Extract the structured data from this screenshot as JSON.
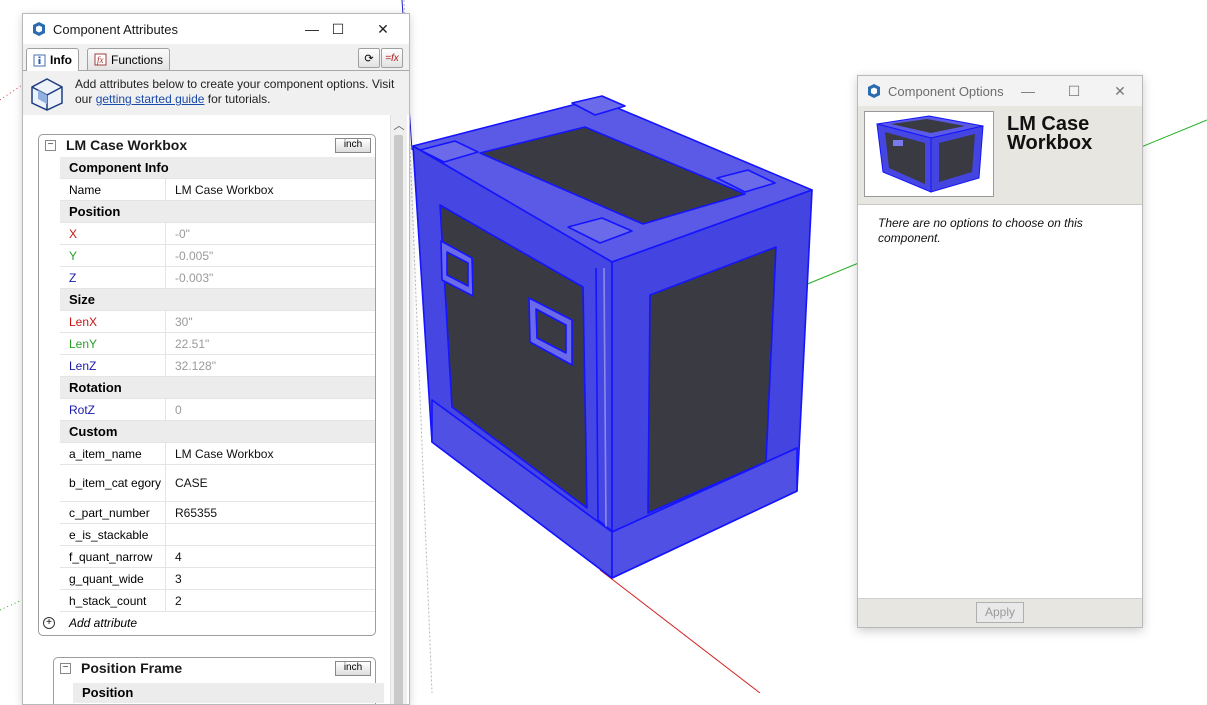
{
  "attributes_window": {
    "title": "Component Attributes",
    "tabs": [
      {
        "label": "Info",
        "icon": "info-icon"
      },
      {
        "label": "Functions",
        "icon": "functions-icon"
      }
    ],
    "toolbar_icons": [
      "refresh-icon",
      "formula-toggle-icon"
    ],
    "banner": {
      "text_before": "Add attributes below to create your component options. Visit our ",
      "link": "getting started guide",
      "text_after": " for tutorials."
    },
    "component": {
      "title": "LM Case Workbox",
      "unit": "inch",
      "groups": [
        {
          "label": "Component Info",
          "rows": [
            {
              "name": "Name",
              "value": "LM Case Workbox",
              "name_color": "default",
              "ghost": false
            }
          ]
        },
        {
          "label": "Position",
          "rows": [
            {
              "name": "X",
              "value": "-0\"",
              "name_color": "#c41515",
              "ghost": true
            },
            {
              "name": "Y",
              "value": "-0.005\"",
              "name_color": "#2aa02a",
              "ghost": true
            },
            {
              "name": "Z",
              "value": "-0.003\"",
              "name_color": "#1a1aa8",
              "ghost": true
            }
          ]
        },
        {
          "label": "Size",
          "rows": [
            {
              "name": "LenX",
              "value": "30\"",
              "name_color": "#c41515",
              "ghost": true
            },
            {
              "name": "LenY",
              "value": "22.51\"",
              "name_color": "#2aa02a",
              "ghost": true
            },
            {
              "name": "LenZ",
              "value": "32.128\"",
              "name_color": "#1a1aa8",
              "ghost": true
            }
          ]
        },
        {
          "label": "Rotation",
          "rows": [
            {
              "name": "RotZ",
              "value": "0",
              "name_color": "#1a1aa8",
              "ghost": true
            }
          ]
        },
        {
          "label": "Custom",
          "rows": [
            {
              "name": "a_item_name",
              "value": "LM Case Workbox",
              "name_color": "default",
              "ghost": false
            },
            {
              "name": "b_item_cat egory",
              "value": "CASE",
              "name_color": "default",
              "ghost": false
            },
            {
              "name": "c_part_number",
              "value": "R65355",
              "name_color": "default",
              "ghost": false
            },
            {
              "name": "e_is_stackable",
              "value": "",
              "name_color": "default",
              "ghost": false
            },
            {
              "name": "f_quant_narrow",
              "value": "4",
              "name_color": "default",
              "ghost": false
            },
            {
              "name": "g_quant_wide",
              "value": "3",
              "name_color": "default",
              "ghost": false
            },
            {
              "name": "h_stack_count",
              "value": "2",
              "name_color": "default",
              "ghost": false
            }
          ]
        }
      ],
      "add_attribute_label": "Add attribute"
    },
    "second_section": {
      "title": "Position Frame",
      "unit": "inch",
      "first_group": "Position"
    }
  },
  "options_window": {
    "title": "Component Options",
    "component_name": "LM Case Workbox",
    "message": "There are no options to choose on this component.",
    "apply_label": "Apply"
  },
  "colors": {
    "selection_blue": "#3333ee",
    "case_face": "#3a3a42",
    "axis_red": "#d62020",
    "axis_green": "#22b022",
    "axis_blue": "#2020d0"
  }
}
